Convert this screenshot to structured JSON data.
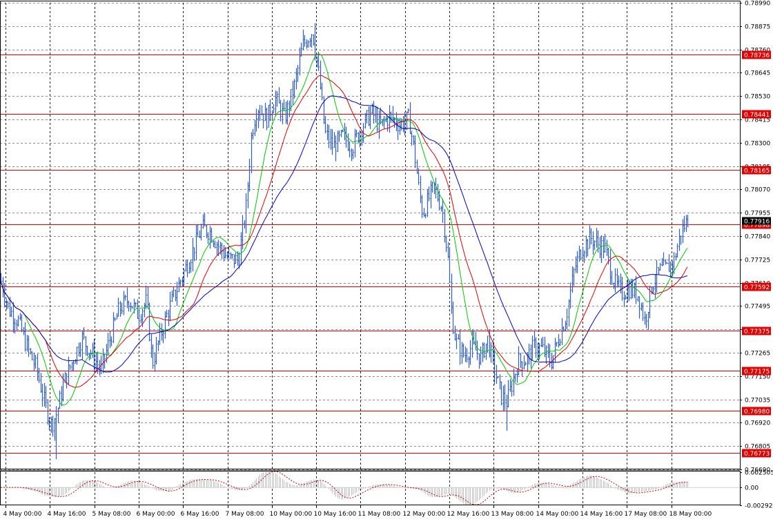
{
  "chart_data": {
    "type": "candlestick",
    "price_axis": {
      "ticks": [
        "0.78990",
        "0.78875",
        "0.78760",
        "0.78645",
        "0.78530",
        "0.78415",
        "0.78300",
        "0.78185",
        "0.78070",
        "0.77955",
        "0.77840",
        "0.77725",
        "0.77610",
        "0.77495",
        "0.77380",
        "0.77265",
        "0.77150",
        "0.77035",
        "0.76920",
        "0.76805",
        "0.76690"
      ],
      "ylim": [
        0.7669,
        0.7899
      ]
    },
    "time_axis": {
      "labels": [
        "4 May 00:00",
        "4 May 16:00",
        "5 May 08:00",
        "6 May 00:00",
        "6 May 16:00",
        "7 May 08:00",
        "10 May 00:00",
        "10 May 16:00",
        "11 May 08:00",
        "12 May 00:00",
        "12 May 16:00",
        "13 May 08:00",
        "14 May 00:00",
        "14 May 16:00",
        "17 May 08:00",
        "18 May 00:00"
      ]
    },
    "current_price": "0.77916",
    "levels": [
      {
        "value": 0.78736,
        "label": "0.78736"
      },
      {
        "value": 0.78441,
        "label": "0.78441"
      },
      {
        "value": 0.78165,
        "label": "0.78165"
      },
      {
        "value": 0.77898,
        "label": "0.77898"
      },
      {
        "value": 0.77592,
        "label": "0.77592"
      },
      {
        "value": 0.77375,
        "label": "0.77375"
      },
      {
        "value": 0.77175,
        "label": "0.77175"
      },
      {
        "value": 0.7698,
        "label": "0.76980"
      },
      {
        "value": 0.76773,
        "label": "0.76773"
      }
    ],
    "price_path": [
      [
        0,
        0.7763
      ],
      [
        12,
        0.7748
      ],
      [
        26,
        0.7742
      ],
      [
        40,
        0.7728
      ],
      [
        52,
        0.7719
      ],
      [
        64,
        0.7702
      ],
      [
        74,
        0.7691
      ],
      [
        82,
        0.7697
      ],
      [
        92,
        0.7712
      ],
      [
        104,
        0.7722
      ],
      [
        118,
        0.7734
      ],
      [
        132,
        0.7726
      ],
      [
        146,
        0.7718
      ],
      [
        160,
        0.7735
      ],
      [
        172,
        0.7748
      ],
      [
        186,
        0.7753
      ],
      [
        200,
        0.7745
      ],
      [
        212,
        0.7752
      ],
      [
        220,
        0.7721
      ],
      [
        230,
        0.7733
      ],
      [
        244,
        0.7748
      ],
      [
        256,
        0.7758
      ],
      [
        268,
        0.7768
      ],
      [
        280,
        0.7778
      ],
      [
        292,
        0.7788
      ],
      [
        304,
        0.7786
      ],
      [
        316,
        0.7779
      ],
      [
        330,
        0.7773
      ],
      [
        345,
        0.7772
      ],
      [
        356,
        0.7798
      ],
      [
        364,
        0.7835
      ],
      [
        372,
        0.7848
      ],
      [
        386,
        0.7842
      ],
      [
        398,
        0.7852
      ],
      [
        412,
        0.7842
      ],
      [
        426,
        0.7858
      ],
      [
        438,
        0.7878
      ],
      [
        452,
        0.7885
      ],
      [
        462,
        0.7862
      ],
      [
        470,
        0.7835
      ],
      [
        482,
        0.7828
      ],
      [
        496,
        0.7833
      ],
      [
        510,
        0.7828
      ],
      [
        524,
        0.7838
      ],
      [
        538,
        0.7845
      ],
      [
        550,
        0.7838
      ],
      [
        564,
        0.7843
      ],
      [
        578,
        0.7839
      ],
      [
        592,
        0.7842
      ],
      [
        600,
        0.7825
      ],
      [
        606,
        0.7808
      ],
      [
        612,
        0.7795
      ],
      [
        620,
        0.7802
      ],
      [
        628,
        0.7808
      ],
      [
        640,
        0.7798
      ],
      [
        648,
        0.7775
      ],
      [
        654,
        0.7745
      ],
      [
        660,
        0.7732
      ],
      [
        672,
        0.7725
      ],
      [
        684,
        0.773
      ],
      [
        696,
        0.7724
      ],
      [
        706,
        0.7733
      ],
      [
        716,
        0.7718
      ],
      [
        726,
        0.7705
      ],
      [
        734,
        0.7702
      ],
      [
        742,
        0.7712
      ],
      [
        750,
        0.7722
      ],
      [
        762,
        0.7723
      ],
      [
        774,
        0.773
      ],
      [
        786,
        0.7728
      ],
      [
        798,
        0.7722
      ],
      [
        810,
        0.7735
      ],
      [
        820,
        0.7745
      ],
      [
        832,
        0.7768
      ],
      [
        842,
        0.7778
      ],
      [
        856,
        0.7783
      ],
      [
        866,
        0.778
      ],
      [
        876,
        0.7778
      ],
      [
        888,
        0.7762
      ],
      [
        900,
        0.7756
      ],
      [
        912,
        0.7758
      ],
      [
        924,
        0.7755
      ],
      [
        934,
        0.7742
      ],
      [
        944,
        0.776
      ],
      [
        956,
        0.7767
      ],
      [
        966,
        0.7768
      ],
      [
        976,
        0.7772
      ],
      [
        986,
        0.7786
      ],
      [
        996,
        0.7792
      ]
    ],
    "moving_averages": [
      {
        "name": "",
        "color": "#00c800",
        "period": 5
      },
      {
        "name": "",
        "color": "#e00000",
        "period": 9
      },
      {
        "name": "",
        "color": "#0000c8",
        "period": 16
      }
    ],
    "oscillator": {
      "ticks": [
        "0.002505",
        "0.00",
        "-0.002926"
      ],
      "ylim": [
        -0.002926,
        0.002505
      ]
    },
    "colors": {
      "candle": "#2c5bd6",
      "level": "#e00000",
      "level_label_bg": "#e00000",
      "current_label_bg": "#000000",
      "grid": "#000000",
      "histogram": "#c0c0c0",
      "signal": "#d00000"
    }
  }
}
